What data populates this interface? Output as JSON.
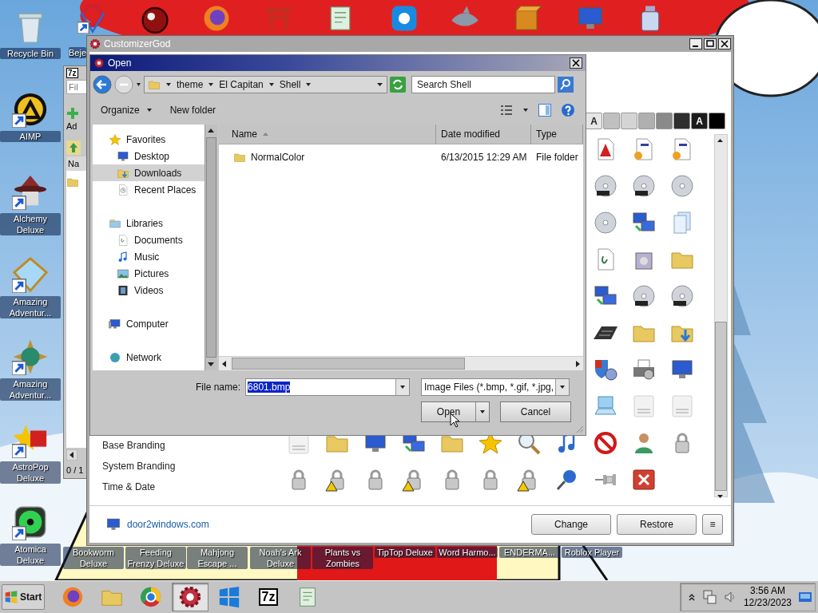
{
  "desktop": {
    "left_icons": [
      {
        "label": "Recycle Bin"
      },
      {
        "label": "AIMP"
      },
      {
        "label": "Alchemy Deluxe"
      },
      {
        "label": "Amazing Adventur..."
      },
      {
        "label": "Amazing Adventur..."
      },
      {
        "label": "AstroPop Deluxe"
      },
      {
        "label": "Atomica Deluxe"
      }
    ],
    "top_icons": [
      {
        "label": "Beje"
      }
    ],
    "bottom_icons": [
      {
        "label": "Bookworm Deluxe"
      },
      {
        "label": "Feeding Frenzy Deluxe"
      },
      {
        "label": "Mahjong Escape ..."
      },
      {
        "label": "Noah's Ark Deluxe"
      },
      {
        "label": "Plants vs Zombies"
      },
      {
        "label": "TipTop Deluxe"
      },
      {
        "label": "Word Harmo..."
      },
      {
        "label": "ENDERMA..."
      },
      {
        "label": "Roblox Player"
      }
    ]
  },
  "archive_window": {
    "logo": "7z",
    "field": "Fil",
    "toolbar_label": "Ad",
    "column": "Na",
    "status": "0 / 1"
  },
  "customizer": {
    "title": "CustomizerGod",
    "swatches": [
      {
        "text": "A",
        "color": "#e6e6e6"
      },
      {
        "color": "#c0c0c0"
      },
      {
        "color": "#d4d4d4"
      },
      {
        "color": "#b0b0b0"
      },
      {
        "color": "#8a8a8a"
      },
      {
        "color": "#2e2e2e"
      },
      {
        "text": "A",
        "color": "#1c1c1c"
      },
      {
        "color": "#000000"
      }
    ],
    "categories": [
      "Base Branding",
      "System Branding",
      "Time & Date"
    ],
    "link": "door2windows.com",
    "buttons": [
      "Change",
      "Restore",
      "≡"
    ]
  },
  "open_dialog": {
    "title": "Open",
    "breadcrumb": [
      "theme",
      "El Capitan",
      "Shell"
    ],
    "search": {
      "placeholder": "Search Shell"
    },
    "toolbar": [
      "Organize",
      "New folder"
    ],
    "navigation": [
      {
        "label": "Favorites",
        "selected": false,
        "children": [
          {
            "label": "Desktop",
            "selected": false
          },
          {
            "label": "Downloads",
            "selected": true
          },
          {
            "label": "Recent Places",
            "selected": false
          }
        ]
      },
      {
        "label": "Libraries",
        "selected": false,
        "children": [
          {
            "label": "Documents",
            "selected": false
          },
          {
            "label": "Music",
            "selected": false
          },
          {
            "label": "Pictures",
            "selected": false
          },
          {
            "label": "Videos",
            "selected": false
          }
        ]
      },
      {
        "label": "Computer",
        "selected": false
      },
      {
        "label": "Network",
        "selected": false
      }
    ],
    "columns": [
      {
        "label": "Name",
        "sorted": true
      },
      {
        "label": "Date modified",
        "sorted": false
      },
      {
        "label": "Type",
        "sorted": false
      }
    ],
    "rows": [
      {
        "name": "NormalColor",
        "date": "6/13/2015 12:29 AM",
        "type": "File folder"
      }
    ],
    "file_name_label": "File name:",
    "file_name": {
      "value": "6801.bmp",
      "selected": true
    },
    "filter": "Image Files (*.bmp, *.gif, *.jpg,",
    "buttons": [
      "Open",
      "Cancel"
    ]
  },
  "taskbar": {
    "start": "Start",
    "items": [
      {
        "selected": false
      },
      {
        "selected": false
      },
      {
        "selected": false
      },
      {
        "selected": true
      },
      {
        "selected": false
      },
      {
        "selected": false,
        "text": "7z"
      },
      {
        "selected": false
      }
    ],
    "time": "3:56 AM",
    "date": "12/23/2023"
  }
}
